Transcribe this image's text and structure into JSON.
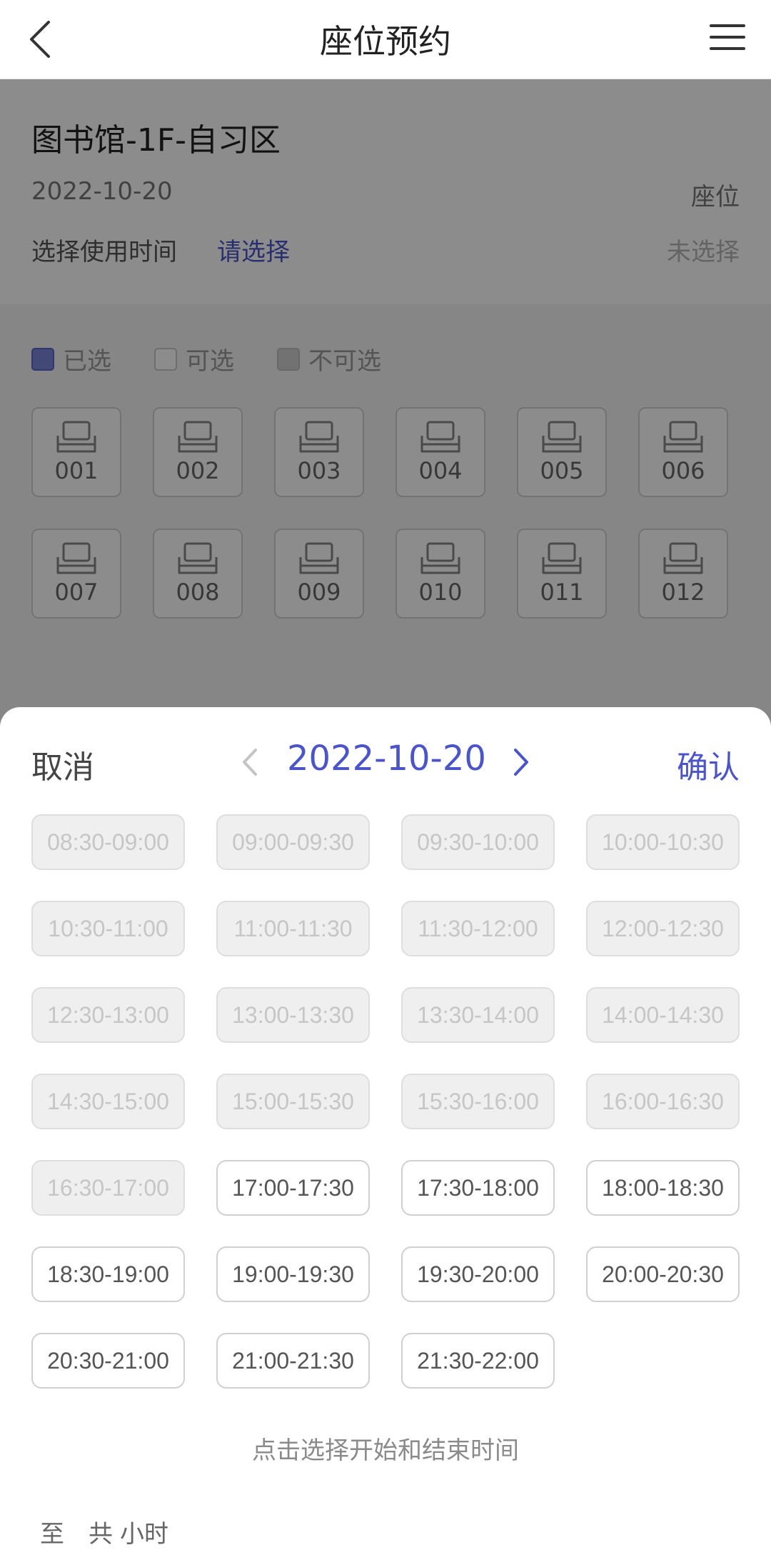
{
  "header": {
    "title": "座位预约"
  },
  "info": {
    "place": "图书馆-1F-自习区",
    "date": "2022-10-20",
    "seat_label": "座位",
    "time_label": "选择使用时间",
    "time_value": "请选择",
    "seat_value": "未选择"
  },
  "legend": {
    "selected": "已选",
    "available": "可选",
    "unavailable": "不可选"
  },
  "seats": [
    "001",
    "002",
    "003",
    "004",
    "005",
    "006",
    "007",
    "008",
    "009",
    "010",
    "011",
    "012"
  ],
  "sheet": {
    "cancel": "取消",
    "date": "2022-10-20",
    "confirm": "确认",
    "hint": "点击选择开始和结束时间",
    "to": "至",
    "total": "共",
    "hours": "小时"
  },
  "slots": [
    {
      "label": "08:30-09:00",
      "available": false
    },
    {
      "label": "09:00-09:30",
      "available": false
    },
    {
      "label": "09:30-10:00",
      "available": false
    },
    {
      "label": "10:00-10:30",
      "available": false
    },
    {
      "label": "10:30-11:00",
      "available": false
    },
    {
      "label": "11:00-11:30",
      "available": false
    },
    {
      "label": "11:30-12:00",
      "available": false
    },
    {
      "label": "12:00-12:30",
      "available": false
    },
    {
      "label": "12:30-13:00",
      "available": false
    },
    {
      "label": "13:00-13:30",
      "available": false
    },
    {
      "label": "13:30-14:00",
      "available": false
    },
    {
      "label": "14:00-14:30",
      "available": false
    },
    {
      "label": "14:30-15:00",
      "available": false
    },
    {
      "label": "15:00-15:30",
      "available": false
    },
    {
      "label": "15:30-16:00",
      "available": false
    },
    {
      "label": "16:00-16:30",
      "available": false
    },
    {
      "label": "16:30-17:00",
      "available": false
    },
    {
      "label": "17:00-17:30",
      "available": true
    },
    {
      "label": "17:30-18:00",
      "available": true
    },
    {
      "label": "18:00-18:30",
      "available": true
    },
    {
      "label": "18:30-19:00",
      "available": true
    },
    {
      "label": "19:00-19:30",
      "available": true
    },
    {
      "label": "19:30-20:00",
      "available": true
    },
    {
      "label": "20:00-20:30",
      "available": true
    },
    {
      "label": "20:30-21:00",
      "available": true
    },
    {
      "label": "21:00-21:30",
      "available": true
    },
    {
      "label": "21:30-22:00",
      "available": true
    }
  ],
  "colors": {
    "accent": "#4b55c8",
    "disabled_bg": "#efefef",
    "overlay": "rgba(0,0,0,0.45)"
  }
}
